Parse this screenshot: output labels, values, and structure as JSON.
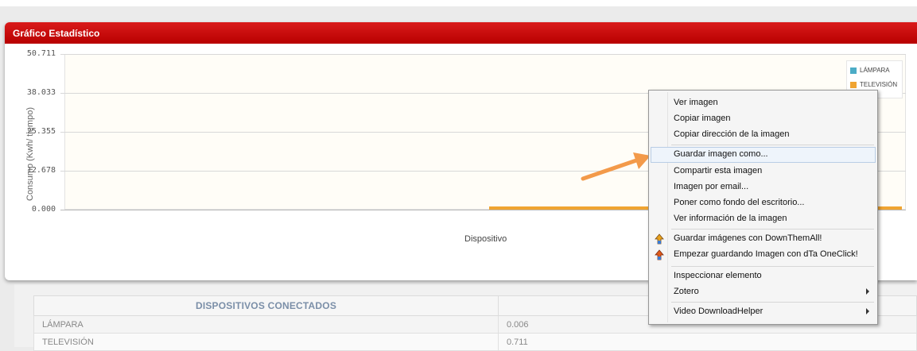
{
  "panel": {
    "title": "Gráfico Estadístico"
  },
  "chart_data": {
    "type": "bar",
    "title": "",
    "xlabel": "Dispositivo",
    "ylabel": "Consumo (Kwh/ tiempo)",
    "ytick_labels": [
      "50.711",
      "38.033",
      "25.355",
      "12.678",
      "0.000"
    ],
    "ylim": [
      0,
      50.711
    ],
    "grid": true,
    "legend_placement": "top-right",
    "series": [
      {
        "name": "LÁMPARA",
        "color": "#4bacc6",
        "values": [
          0.006
        ]
      },
      {
        "name": "TELEVISIÓN",
        "color": "#f0a431",
        "values": [
          0.711
        ]
      }
    ]
  },
  "table": {
    "header": "DISPOSITIVOS CONECTADOS",
    "rows": [
      {
        "device": "LÁMPARA",
        "value": "0.006"
      },
      {
        "device": "TELEVISIÓN",
        "value": "0.711"
      }
    ]
  },
  "arrow_color": "#f39a4a",
  "context_menu": {
    "items": [
      {
        "label": "Ver imagen"
      },
      {
        "label": "Copiar imagen"
      },
      {
        "label": "Copiar dirección de la imagen"
      },
      {
        "label": "Guardar imagen como..."
      },
      {
        "label": "Compartir esta imagen"
      },
      {
        "label": "Imagen por email..."
      },
      {
        "label": "Poner como fondo del escritorio..."
      },
      {
        "label": "Ver información de la imagen"
      },
      {
        "label": "Guardar imágenes con DownThemAll!",
        "icon": "downthemall-icon"
      },
      {
        "label": "Empezar guardando Imagen con dTa OneClick!",
        "icon": "dta-oneclick-icon"
      },
      {
        "label": "Inspeccionar elemento"
      },
      {
        "label": "Zotero",
        "submenu": true
      },
      {
        "label": "Video DownloadHelper",
        "submenu": true
      }
    ]
  }
}
